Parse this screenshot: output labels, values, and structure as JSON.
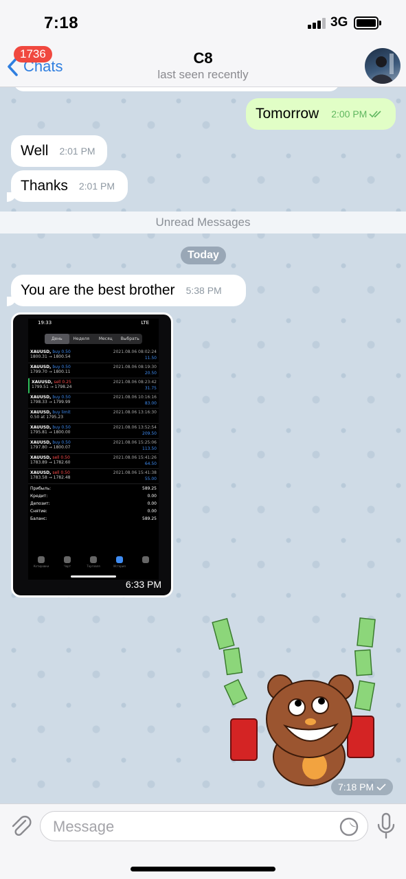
{
  "status_bar": {
    "time": "7:18",
    "network": "3G"
  },
  "header": {
    "back_label": "Chats",
    "unread_badge": "1736",
    "title": "C8",
    "subtitle": "last seen recently"
  },
  "messages": [
    {
      "type": "outgoing",
      "text": "Tomorrow",
      "time": "2:00 PM"
    },
    {
      "type": "incoming",
      "text": "Well",
      "time": "2:01 PM"
    },
    {
      "type": "incoming",
      "text": "Thanks",
      "time": "2:01 PM"
    },
    {
      "type": "incoming",
      "text": "You are the best brother",
      "time": "5:38 PM"
    }
  ],
  "unread_divider": "Unread Messages",
  "date_divider": "Today",
  "image_message": {
    "time": "6:33 PM",
    "screenshot": {
      "status_time": "19:33",
      "status_net": "LTE",
      "tabs": [
        "День",
        "Неделя",
        "Месяц",
        "Выбрать"
      ],
      "trades": [
        {
          "symbol": "XAUUSD,",
          "action": "buy 0.50",
          "side": "buy",
          "datetime": "2021.08.06 08:02:24",
          "prices": "1800.31 → 1800.54",
          "profit": "11.50"
        },
        {
          "symbol": "XAUUSD,",
          "action": "buy 0.50",
          "side": "buy",
          "datetime": "2021.08.06 08:19:30",
          "prices": "1799.70 → 1800.11",
          "profit": "20.50"
        },
        {
          "symbol": "XAUUSD,",
          "action": "sell 0.25",
          "side": "sell",
          "datetime": "2021.08.06 08:23:42",
          "prices": "1799.51 → 1798.24",
          "profit": "31.75"
        },
        {
          "symbol": "XAUUSD,",
          "action": "buy 0.50",
          "side": "buy",
          "datetime": "2021.08.06 10:16:16",
          "prices": "1798.33 → 1799.99",
          "profit": "83.00"
        },
        {
          "symbol": "XAUUSD,",
          "action": "buy limit",
          "side": "buy",
          "datetime": "2021.08.06 13:16:30",
          "prices": "0.50 at 1795.23",
          "profit": ""
        },
        {
          "symbol": "XAUUSD,",
          "action": "buy 0.50",
          "side": "buy",
          "datetime": "2021.08.06 13:52:54",
          "prices": "1795.81 → 1800.00",
          "profit": "209.50"
        },
        {
          "symbol": "XAUUSD,",
          "action": "buy 0.50",
          "side": "buy",
          "datetime": "2021.08.06 15:25:06",
          "prices": "1797.80 → 1800.07",
          "profit": "113.50"
        },
        {
          "symbol": "XAUUSD,",
          "action": "sell 0.50",
          "side": "sell",
          "datetime": "2021.08.06 15:41:26",
          "prices": "1783.89 → 1782.60",
          "profit": "64.50"
        },
        {
          "symbol": "XAUUSD,",
          "action": "sell 0.50",
          "side": "sell",
          "datetime": "2021.08.06 15:41:38",
          "prices": "1783.58 → 1782.48",
          "profit": "55.00"
        }
      ],
      "summary": [
        {
          "label": "Прибыль:",
          "value": "589.25"
        },
        {
          "label": "Кредит:",
          "value": "0.00"
        },
        {
          "label": "Депозит:",
          "value": "0.00"
        },
        {
          "label": "Снятие:",
          "value": "0.00"
        },
        {
          "label": "Баланс:",
          "value": "589.25"
        }
      ],
      "nav": [
        "Котировки",
        "Чарт",
        "Торговля",
        "История",
        ""
      ]
    }
  },
  "sticker": {
    "time": "7:18 PM",
    "description_icon": "bear-money-sticker-icon"
  },
  "input": {
    "placeholder": "Message"
  },
  "colors": {
    "accent": "#2f7fe0",
    "badge": "#f0483f",
    "outgoing_bubble": "#e1fec6",
    "buy": "#3f8cf2",
    "sell": "#ff4b4b"
  }
}
